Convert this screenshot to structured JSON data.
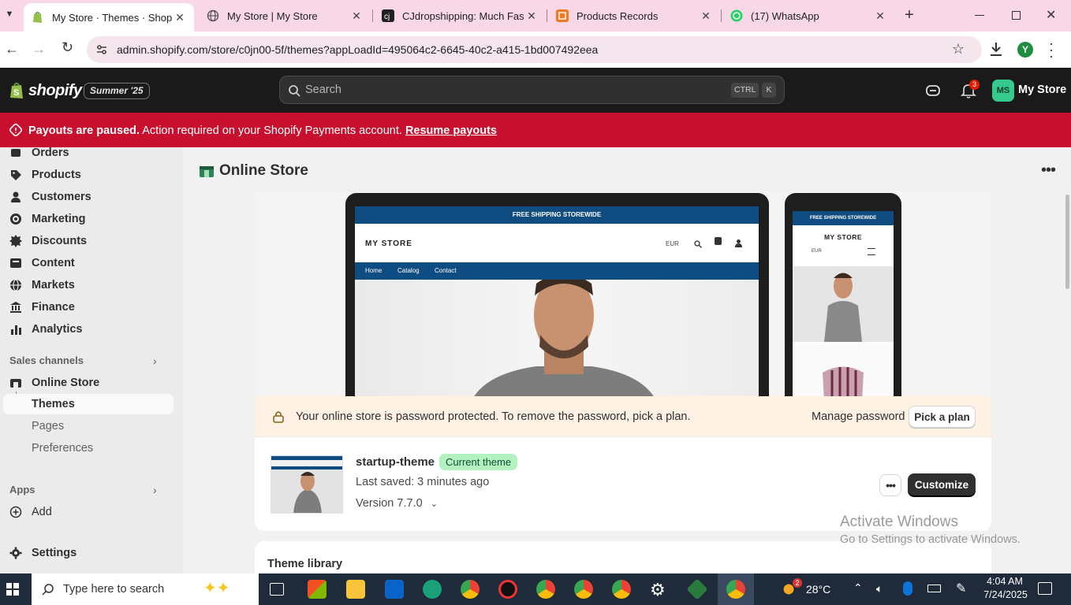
{
  "browser": {
    "tabs": [
      {
        "title": "My Store · Themes · Shopify",
        "active": true
      },
      {
        "title": "My Store | My Store",
        "active": false
      },
      {
        "title": "CJdropshipping: Much Faste",
        "active": false
      },
      {
        "title": "Products Records",
        "active": false
      },
      {
        "title": "(17) WhatsApp",
        "active": false
      }
    ],
    "url": "admin.shopify.com/store/c0jn00-5f/themes?appLoadId=495064c2-6645-40c2-a415-1bd007492eea",
    "profile_initial": "Y"
  },
  "header": {
    "logo_text": "shopify",
    "edition_badge": "Summer '25",
    "search_placeholder": "Search",
    "shortcut_ctrl": "CTRL",
    "shortcut_k": "K",
    "notification_count": "3",
    "store_initials": "MS",
    "store_name": "My Store"
  },
  "banner": {
    "bold": "Payouts are paused.",
    "text": "Action required on your Shopify Payments account.",
    "link": "Resume payouts"
  },
  "sidebar": {
    "items": [
      {
        "label": "Orders",
        "icon": "orders-icon"
      },
      {
        "label": "Products",
        "icon": "tag-icon"
      },
      {
        "label": "Customers",
        "icon": "person-icon"
      },
      {
        "label": "Marketing",
        "icon": "target-icon"
      },
      {
        "label": "Discounts",
        "icon": "discount-icon"
      },
      {
        "label": "Content",
        "icon": "content-icon"
      },
      {
        "label": "Markets",
        "icon": "globe-icon"
      },
      {
        "label": "Finance",
        "icon": "bank-icon"
      },
      {
        "label": "Analytics",
        "icon": "bar-chart-icon"
      }
    ],
    "sales_channels_label": "Sales channels",
    "online_store_label": "Online Store",
    "sub_items": [
      "Themes",
      "Pages",
      "Preferences"
    ],
    "apps_label": "Apps",
    "add_label": "Add",
    "settings_label": "Settings"
  },
  "page": {
    "title": "Online Store",
    "preview": {
      "top_bar": "FREE SHIPPING STOREWIDE",
      "store_name": "MY STORE",
      "currency": "EUR",
      "nav": [
        "Home",
        "Catalog",
        "Contact"
      ]
    },
    "password_notice": "Your online store is password protected. To remove the password, pick a plan.",
    "manage_password": "Manage password",
    "pick_plan": "Pick a plan",
    "theme": {
      "name": "startup-theme",
      "badge": "Current theme",
      "last_saved": "Last saved: 3 minutes ago",
      "version": "Version 7.7.0",
      "customize": "Customize"
    },
    "theme_library": "Theme library"
  },
  "watermark": {
    "line1": "Activate Windows",
    "line2": "Go to Settings to activate Windows."
  },
  "taskbar": {
    "search_placeholder": "Type here to search",
    "weather_badge": "2",
    "temperature": "28°C",
    "time": "4:04 AM",
    "date": "7/24/2025"
  },
  "colors": {
    "banner_red": "#c8102e",
    "shopify_green": "#95bf47",
    "current_theme_badge": "#b4f1c1",
    "tab_strip": "#f8d7e6",
    "notice_bg": "#fff1e3"
  }
}
